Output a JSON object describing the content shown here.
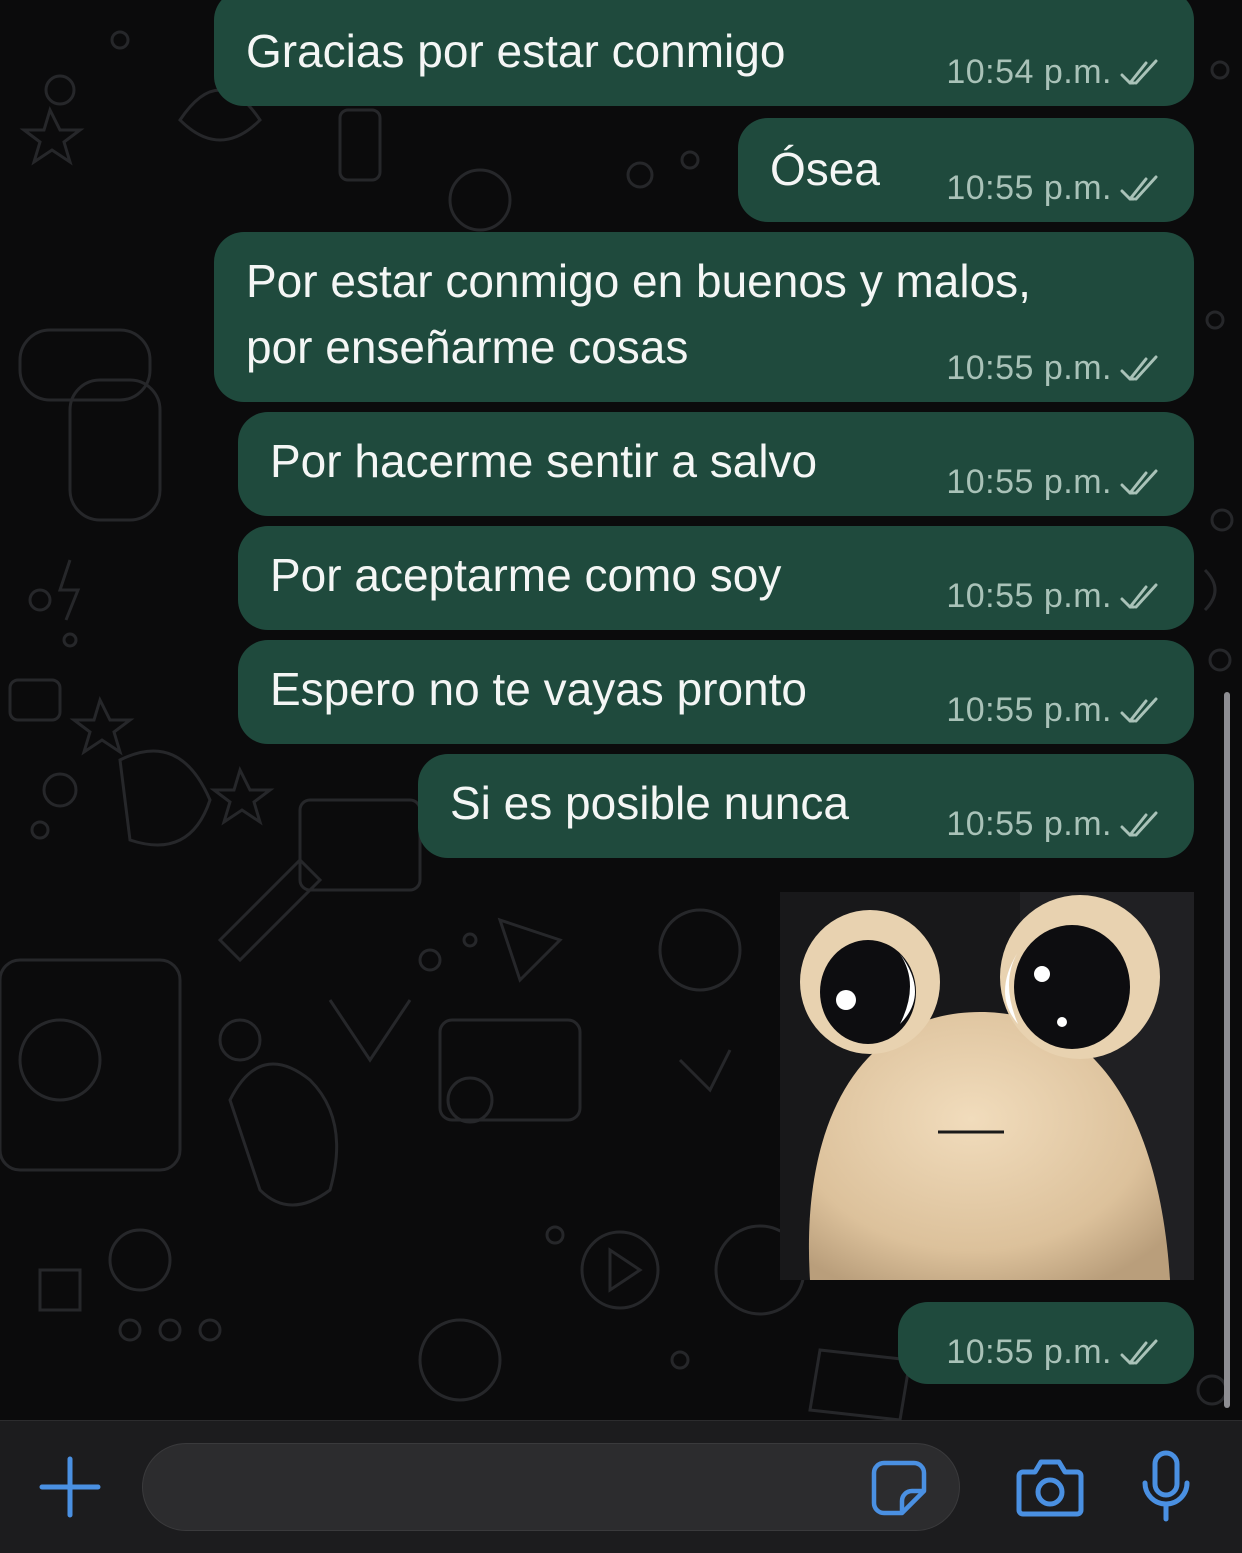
{
  "messages": [
    {
      "text": "Gracias por estar conmigo",
      "time": "10:54 p.m."
    },
    {
      "text": "Ósea",
      "time": "10:55 p.m."
    },
    {
      "line1": "Por estar conmigo en buenos y malos,",
      "line2": "por enseñarme cosas",
      "time": "10:55 p.m."
    },
    {
      "text": "Por hacerme sentir a salvo",
      "time": "10:55 p.m."
    },
    {
      "text": "Por aceptarme como soy",
      "time": "10:55 p.m."
    },
    {
      "text": "Espero no te vayas pronto",
      "time": "10:55 p.m."
    },
    {
      "text": "Si es posible nunca",
      "time": "10:55 p.m."
    },
    {
      "time": "10:55 p.m."
    }
  ],
  "colors": {
    "bubble": "#1f4a3d",
    "accent": "#4a90e2",
    "ticks": "#a9c2b8",
    "background": "#0b0b0c"
  },
  "icons": {
    "add": "plus-icon",
    "sticker": "sticker-icon",
    "camera": "camera-icon",
    "mic": "microphone-icon",
    "read_receipt": "double-check-icon"
  }
}
